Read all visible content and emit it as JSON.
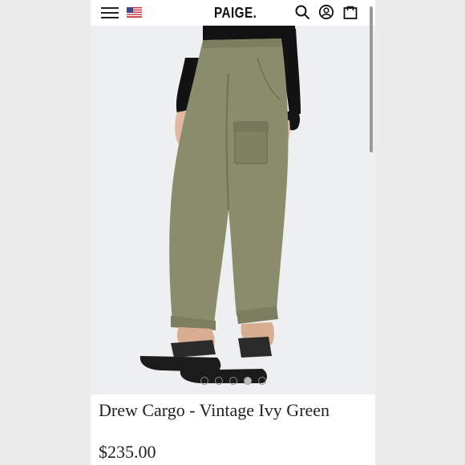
{
  "header": {
    "logo": "PAIGE.",
    "menu_icon": "hamburger-menu-icon",
    "flag_icon": "us-flag-icon",
    "search_icon": "search-icon",
    "account_icon": "account-icon",
    "bag_icon": "shopping-bag-icon"
  },
  "gallery": {
    "image_count": 5,
    "active_index": 3
  },
  "product": {
    "title": "Drew Cargo - Vintage Ivy Green",
    "price": "$235.00"
  },
  "colors": {
    "pant": "#8a8d6c",
    "background": "#eeeff0",
    "text": "#222222"
  }
}
